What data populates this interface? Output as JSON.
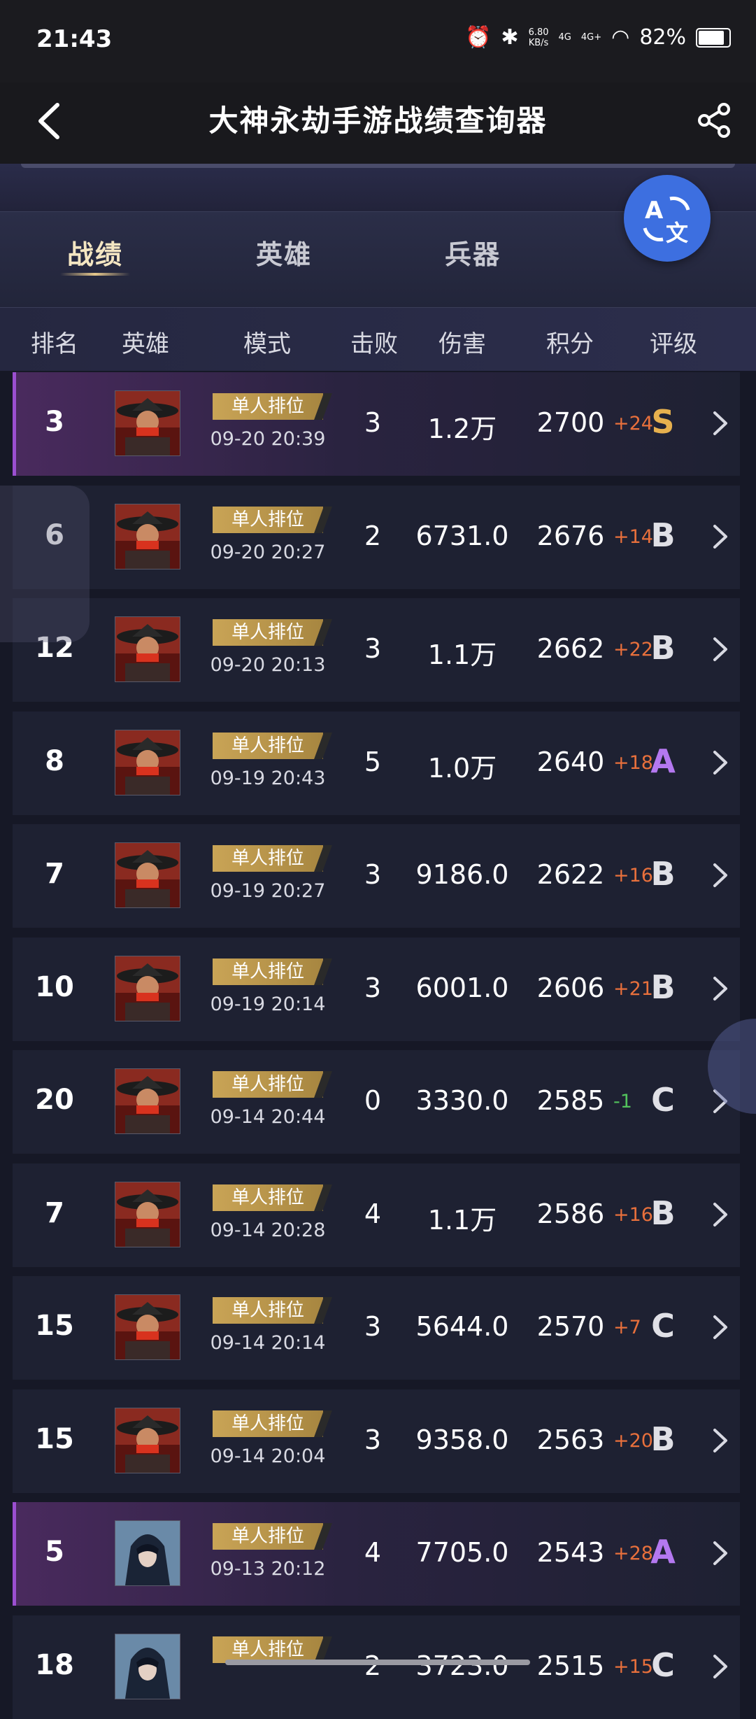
{
  "status_bar": {
    "time": "21:43",
    "net_speed_top": "6.80",
    "net_speed_unit": "KB/s",
    "signal_1": "4G",
    "signal_2": "4G+",
    "battery": "82%"
  },
  "nav": {
    "title": "大神永劫手游战绩查询器",
    "back_icon": "chevron-left-icon",
    "share_icon": "share-icon"
  },
  "tabs": [
    {
      "label": "战绩",
      "active": true
    },
    {
      "label": "英雄",
      "active": false
    },
    {
      "label": "兵器",
      "active": false
    }
  ],
  "translate_icon": "translate-icon",
  "columns": [
    "排名",
    "英雄",
    "模式",
    "击败",
    "伤害",
    "积分",
    "评级"
  ],
  "colors": {
    "accent_gold": "#c9a456",
    "delta_positive": "#e8703c",
    "delta_negative": "#52c25c",
    "grade_S": "#e6b04e",
    "grade_A": "#b478f0",
    "grade_B": "#e0e0e6",
    "grade_C": "#e0e0e6",
    "highlight_row": "#4a2a5e"
  },
  "rows": [
    {
      "rank": "3",
      "hero": "hat-warrior",
      "mode": "单人排位",
      "datetime": "09-20 20:39",
      "kills": "3",
      "damage": "1.2万",
      "score": "2700",
      "delta": "+24",
      "grade": "S",
      "highlight": true
    },
    {
      "rank": "6",
      "hero": "hat-warrior",
      "mode": "单人排位",
      "datetime": "09-20 20:27",
      "kills": "2",
      "damage": "6731.0",
      "score": "2676",
      "delta": "+14",
      "grade": "B",
      "highlight": false
    },
    {
      "rank": "12",
      "hero": "hat-warrior",
      "mode": "单人排位",
      "datetime": "09-20 20:13",
      "kills": "3",
      "damage": "1.1万",
      "score": "2662",
      "delta": "+22",
      "grade": "B",
      "highlight": false
    },
    {
      "rank": "8",
      "hero": "hat-warrior",
      "mode": "单人排位",
      "datetime": "09-19 20:43",
      "kills": "5",
      "damage": "1.0万",
      "score": "2640",
      "delta": "+18",
      "grade": "A",
      "highlight": false
    },
    {
      "rank": "7",
      "hero": "hat-warrior",
      "mode": "单人排位",
      "datetime": "09-19 20:27",
      "kills": "3",
      "damage": "9186.0",
      "score": "2622",
      "delta": "+16",
      "grade": "B",
      "highlight": false
    },
    {
      "rank": "10",
      "hero": "hat-warrior",
      "mode": "单人排位",
      "datetime": "09-19 20:14",
      "kills": "3",
      "damage": "6001.0",
      "score": "2606",
      "delta": "+21",
      "grade": "B",
      "highlight": false
    },
    {
      "rank": "20",
      "hero": "hat-warrior",
      "mode": "单人排位",
      "datetime": "09-14 20:44",
      "kills": "0",
      "damage": "3330.0",
      "score": "2585",
      "delta": "-1",
      "grade": "C",
      "highlight": false
    },
    {
      "rank": "7",
      "hero": "hat-warrior",
      "mode": "单人排位",
      "datetime": "09-14 20:28",
      "kills": "4",
      "damage": "1.1万",
      "score": "2586",
      "delta": "+16",
      "grade": "B",
      "highlight": false
    },
    {
      "rank": "15",
      "hero": "hat-warrior",
      "mode": "单人排位",
      "datetime": "09-14 20:14",
      "kills": "3",
      "damage": "5644.0",
      "score": "2570",
      "delta": "+7",
      "grade": "C",
      "highlight": false
    },
    {
      "rank": "15",
      "hero": "hat-warrior",
      "mode": "单人排位",
      "datetime": "09-14 20:04",
      "kills": "3",
      "damage": "9358.0",
      "score": "2563",
      "delta": "+20",
      "grade": "B",
      "highlight": false
    },
    {
      "rank": "5",
      "hero": "hooded-assassin",
      "mode": "单人排位",
      "datetime": "09-13 20:12",
      "kills": "4",
      "damage": "7705.0",
      "score": "2543",
      "delta": "+28",
      "grade": "A",
      "highlight": true
    },
    {
      "rank": "18",
      "hero": "hooded-assassin",
      "mode": "单人排位",
      "datetime": "",
      "kills": "2",
      "damage": "3723.0",
      "score": "2515",
      "delta": "+15",
      "grade": "C",
      "highlight": false
    }
  ]
}
